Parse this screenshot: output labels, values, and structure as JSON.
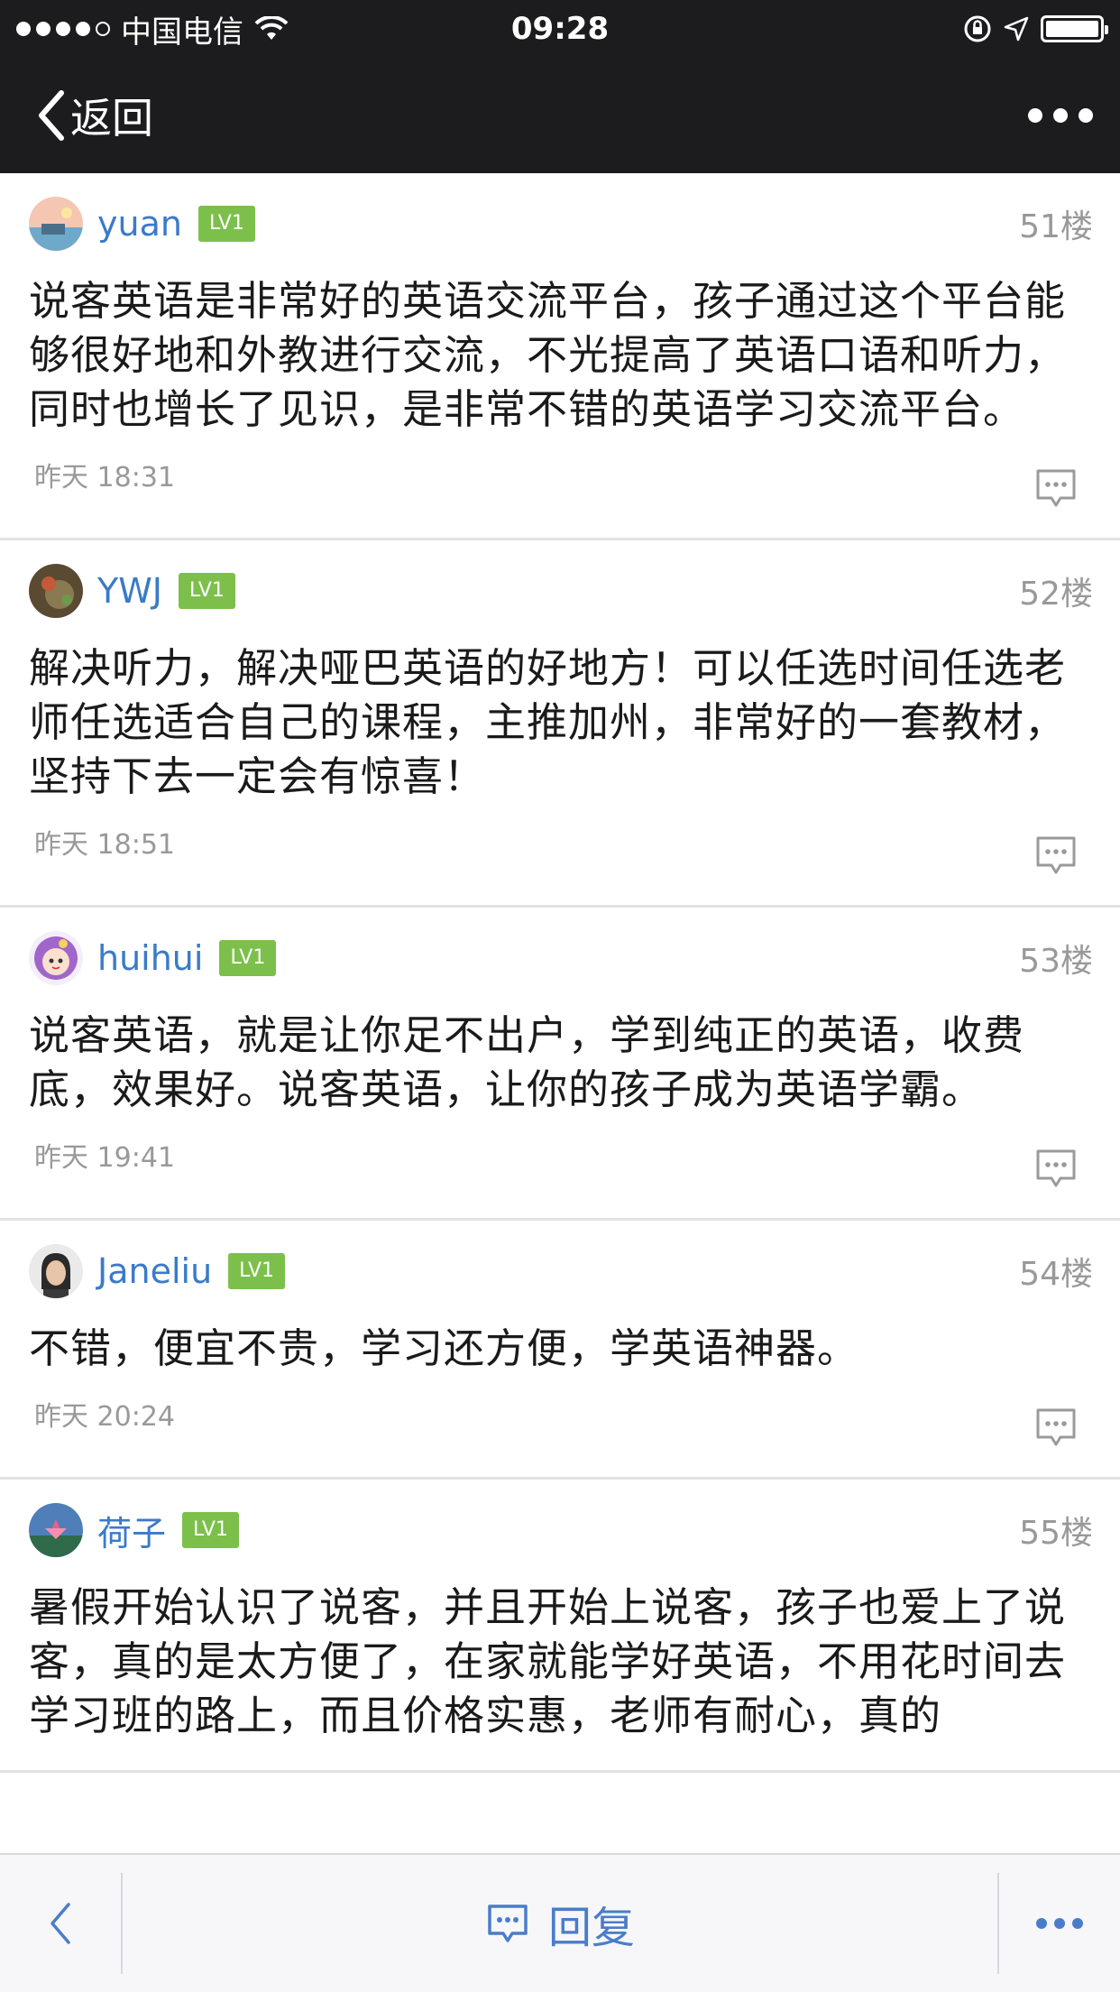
{
  "status_bar": {
    "carrier": "中国电信",
    "time": "09:28"
  },
  "nav": {
    "back_label": "返回"
  },
  "posts": [
    {
      "username": "yuan",
      "level": "LV1",
      "floor": "51楼",
      "text": "说客英语是非常好的英语交流平台，孩子通过这个平台能够很好地和外教进行交流，不光提高了英语口语和听力，同时也增长了见识，是非常不错的英语学习交流平台。",
      "time": "昨天 18:31"
    },
    {
      "username": "YWJ",
      "level": "LV1",
      "floor": "52楼",
      "text": "解决听力，解决哑巴英语的好地方！可以任选时间任选老师任选适合自己的课程，主推加州，非常好的一套教材，坚持下去一定会有惊喜！",
      "time": "昨天 18:51"
    },
    {
      "username": "huihui",
      "level": "LV1",
      "floor": "53楼",
      "text": "说客英语，就是让你足不出户，学到纯正的英语，收费底，效果好。说客英语，让你的孩子成为英语学霸。",
      "time": "昨天 19:41"
    },
    {
      "username": "Janeliu",
      "level": "LV1",
      "floor": "54楼",
      "text": "不错，便宜不贵，学习还方便，学英语神器。",
      "time": "昨天 20:24"
    },
    {
      "username": "荷子",
      "level": "LV1",
      "floor": "55楼",
      "text": "暑假开始认识了说客，并且开始上说客，孩子也爱上了说客，真的是太方便了，在家就能学好英语，不用花时间去学习班的路上，而且价格实惠，老师有耐心，真的",
      "time": ""
    }
  ],
  "bottom_bar": {
    "reply_label": "回复"
  },
  "colors": {
    "header_bg": "#1c1c1e",
    "username": "#3a7bc8",
    "badge_bg": "#7cc04b",
    "meta_text": "#999999",
    "accent_blue": "#4a7dc9"
  }
}
